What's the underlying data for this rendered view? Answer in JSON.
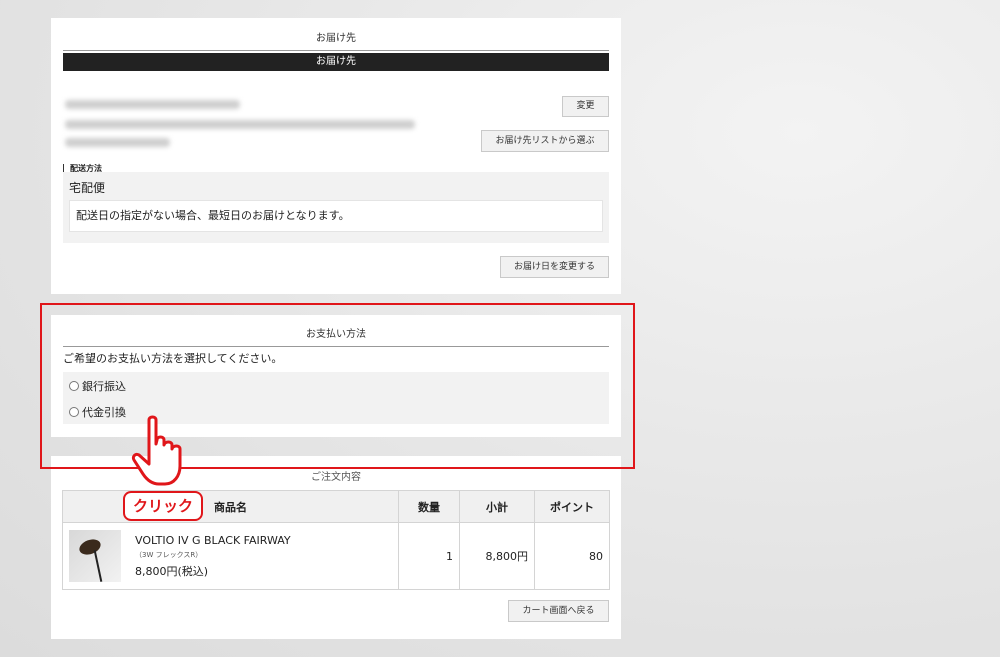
{
  "delivery": {
    "section_title": "お届け先",
    "bar_title": "お届け先",
    "change_label": "変更",
    "choose_list_label": "お届け先リストから選ぶ",
    "shipping_label": "配送方法",
    "shipping_method": "宅配便",
    "shipping_note": "配送日の指定がない場合、最短日のお届けとなります。",
    "change_date_label": "お届け日を変更する"
  },
  "payment": {
    "section_title": "お支払い方法",
    "prompt": "ご希望のお支払い方法を選択してください。",
    "options": [
      {
        "label": "銀行振込",
        "selected": false
      },
      {
        "label": "代金引換",
        "selected": false
      }
    ]
  },
  "order": {
    "section_title": "ご注文内容",
    "headers": {
      "name": "商品名",
      "qty": "数量",
      "subtotal": "小計",
      "points": "ポイント"
    },
    "items": [
      {
        "name": "VOLTIO IV G BLACK FAIRWAY",
        "spec": "（3W フレックスR）",
        "price": "8,800円(税込)",
        "qty": "1",
        "subtotal": "8,800円",
        "points": "80"
      }
    ],
    "back_label": "カート画面へ戻る"
  },
  "annotation": {
    "click_label": "クリック",
    "highlight_color": "#e0161a"
  }
}
